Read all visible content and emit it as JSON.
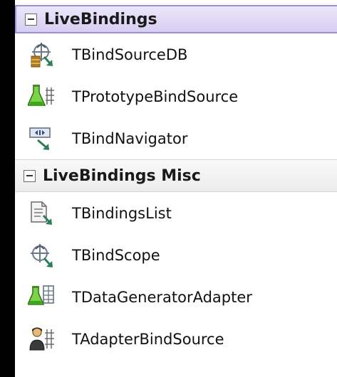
{
  "palette": {
    "categories": [
      {
        "title": "LiveBindings",
        "items": [
          {
            "label": "TBindSourceDB",
            "icon": "bindsource-db-icon"
          },
          {
            "label": "TPrototypeBindSource",
            "icon": "prototype-bindsource-icon"
          },
          {
            "label": "TBindNavigator",
            "icon": "bind-navigator-icon"
          }
        ]
      },
      {
        "title": "LiveBindings Misc",
        "items": [
          {
            "label": "TBindingsList",
            "icon": "bindings-list-icon"
          },
          {
            "label": "TBindScope",
            "icon": "bind-scope-icon"
          },
          {
            "label": "TDataGeneratorAdapter",
            "icon": "data-generator-adapter-icon"
          },
          {
            "label": "TAdapterBindSource",
            "icon": "adapter-bindsource-icon"
          }
        ]
      }
    ]
  }
}
